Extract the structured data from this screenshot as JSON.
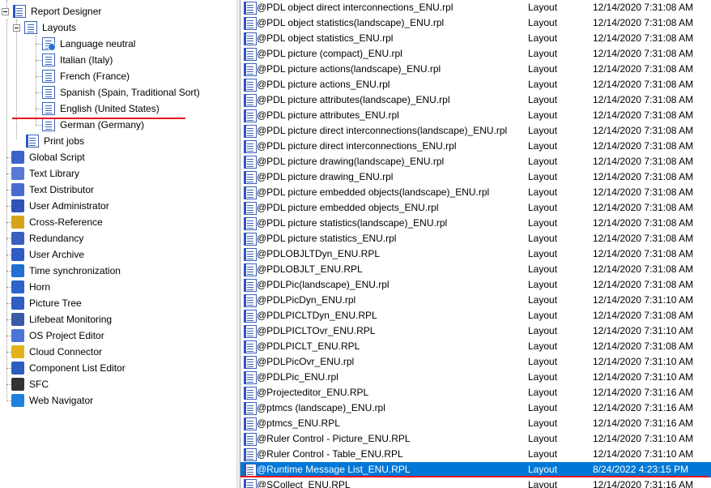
{
  "tree": {
    "root_label": "Report Designer",
    "layouts_label": "Layouts",
    "languages": [
      "Language neutral",
      "Italian (Italy)",
      "French (France)",
      "Spanish (Spain, Traditional Sort)",
      "English (United States)",
      "German (Germany)"
    ],
    "print_jobs_label": "Print jobs",
    "items": [
      {
        "label": "Global Script",
        "icon": "global-script-icon",
        "color": "#3c64c8"
      },
      {
        "label": "Text Library",
        "icon": "text-library-icon",
        "color": "#5a7ad6"
      },
      {
        "label": "Text Distributor",
        "icon": "text-distributor-icon",
        "color": "#4a6bd0"
      },
      {
        "label": "User Administrator",
        "icon": "user-administrator-icon",
        "color": "#2f54b8"
      },
      {
        "label": "Cross-Reference",
        "icon": "cross-reference-icon",
        "color": "#d4a51a"
      },
      {
        "label": "Redundancy",
        "icon": "redundancy-icon",
        "color": "#3a5fbf"
      },
      {
        "label": "User Archive",
        "icon": "user-archive-icon",
        "color": "#2f5bc4"
      },
      {
        "label": "Time synchronization",
        "icon": "time-synchronization-icon",
        "color": "#1f70d0"
      },
      {
        "label": "Horn",
        "icon": "horn-icon",
        "color": "#2e64c8"
      },
      {
        "label": "Picture Tree",
        "icon": "picture-tree-icon",
        "color": "#2f5ec0"
      },
      {
        "label": "Lifebeat Monitoring",
        "icon": "lifebeat-monitoring-icon",
        "color": "#3a5aa8"
      },
      {
        "label": "OS Project Editor",
        "icon": "os-project-editor-icon",
        "color": "#4a74d6"
      },
      {
        "label": "Cloud Connector",
        "icon": "cloud-connector-icon",
        "color": "#e0b31a"
      },
      {
        "label": "Component List Editor",
        "icon": "component-list-editor-icon",
        "color": "#2b5dc0"
      },
      {
        "label": "SFC",
        "icon": "sfc-icon",
        "color": "#333333"
      },
      {
        "label": "Web Navigator",
        "icon": "web-navigator-icon",
        "color": "#1f80e0"
      }
    ]
  },
  "files": [
    {
      "name": "@PDL object direct interconnections_ENU.rpl",
      "type": "Layout",
      "date": "12/14/2020 7:31:08 AM"
    },
    {
      "name": "@PDL object statistics(landscape)_ENU.rpl",
      "type": "Layout",
      "date": "12/14/2020 7:31:08 AM"
    },
    {
      "name": "@PDL object statistics_ENU.rpl",
      "type": "Layout",
      "date": "12/14/2020 7:31:08 AM"
    },
    {
      "name": "@PDL picture (compact)_ENU.rpl",
      "type": "Layout",
      "date": "12/14/2020 7:31:08 AM"
    },
    {
      "name": "@PDL picture actions(landscape)_ENU.rpl",
      "type": "Layout",
      "date": "12/14/2020 7:31:08 AM"
    },
    {
      "name": "@PDL picture actions_ENU.rpl",
      "type": "Layout",
      "date": "12/14/2020 7:31:08 AM"
    },
    {
      "name": "@PDL picture attributes(landscape)_ENU.rpl",
      "type": "Layout",
      "date": "12/14/2020 7:31:08 AM"
    },
    {
      "name": "@PDL picture attributes_ENU.rpl",
      "type": "Layout",
      "date": "12/14/2020 7:31:08 AM"
    },
    {
      "name": "@PDL picture direct interconnections(landscape)_ENU.rpl",
      "type": "Layout",
      "date": "12/14/2020 7:31:08 AM"
    },
    {
      "name": "@PDL picture direct interconnections_ENU.rpl",
      "type": "Layout",
      "date": "12/14/2020 7:31:08 AM"
    },
    {
      "name": "@PDL picture drawing(landscape)_ENU.rpl",
      "type": "Layout",
      "date": "12/14/2020 7:31:08 AM"
    },
    {
      "name": "@PDL picture drawing_ENU.rpl",
      "type": "Layout",
      "date": "12/14/2020 7:31:08 AM"
    },
    {
      "name": "@PDL picture embedded objects(landscape)_ENU.rpl",
      "type": "Layout",
      "date": "12/14/2020 7:31:08 AM"
    },
    {
      "name": "@PDL picture embedded objects_ENU.rpl",
      "type": "Layout",
      "date": "12/14/2020 7:31:08 AM"
    },
    {
      "name": "@PDL picture statistics(landscape)_ENU.rpl",
      "type": "Layout",
      "date": "12/14/2020 7:31:08 AM"
    },
    {
      "name": "@PDL picture statistics_ENU.rpl",
      "type": "Layout",
      "date": "12/14/2020 7:31:08 AM"
    },
    {
      "name": "@PDLOBJLTDyn_ENU.RPL",
      "type": "Layout",
      "date": "12/14/2020 7:31:08 AM"
    },
    {
      "name": "@PDLOBJLT_ENU.RPL",
      "type": "Layout",
      "date": "12/14/2020 7:31:08 AM"
    },
    {
      "name": "@PDLPic(landscape)_ENU.rpl",
      "type": "Layout",
      "date": "12/14/2020 7:31:08 AM"
    },
    {
      "name": "@PDLPicDyn_ENU.rpl",
      "type": "Layout",
      "date": "12/14/2020 7:31:10 AM"
    },
    {
      "name": "@PDLPICLTDyn_ENU.RPL",
      "type": "Layout",
      "date": "12/14/2020 7:31:08 AM"
    },
    {
      "name": "@PDLPICLTOvr_ENU.RPL",
      "type": "Layout",
      "date": "12/14/2020 7:31:10 AM"
    },
    {
      "name": "@PDLPICLT_ENU.RPL",
      "type": "Layout",
      "date": "12/14/2020 7:31:08 AM"
    },
    {
      "name": "@PDLPicOvr_ENU.rpl",
      "type": "Layout",
      "date": "12/14/2020 7:31:10 AM"
    },
    {
      "name": "@PDLPic_ENU.rpl",
      "type": "Layout",
      "date": "12/14/2020 7:31:10 AM"
    },
    {
      "name": "@Projecteditor_ENU.RPL",
      "type": "Layout",
      "date": "12/14/2020 7:31:16 AM"
    },
    {
      "name": "@ptmcs (landscape)_ENU.rpl",
      "type": "Layout",
      "date": "12/14/2020 7:31:16 AM"
    },
    {
      "name": "@ptmcs_ENU.RPL",
      "type": "Layout",
      "date": "12/14/2020 7:31:16 AM"
    },
    {
      "name": "@Ruler Control - Picture_ENU.RPL",
      "type": "Layout",
      "date": "12/14/2020 7:31:10 AM"
    },
    {
      "name": "@Ruler Control - Table_ENU.RPL",
      "type": "Layout",
      "date": "12/14/2020 7:31:10 AM"
    },
    {
      "name": "@Runtime Message List_ENU.RPL",
      "type": "Layout",
      "date": "8/24/2022 4:23:15 PM"
    },
    {
      "name": "@SCollect_ENU.RPL",
      "type": "Layout",
      "date": "12/14/2020 7:31:16 AM"
    }
  ],
  "selected_file": "@Runtime Message List_ENU.RPL",
  "highlighted_language": "English (United States)",
  "colors": {
    "selection": "#0078d7",
    "annotation": "#e8121b"
  }
}
